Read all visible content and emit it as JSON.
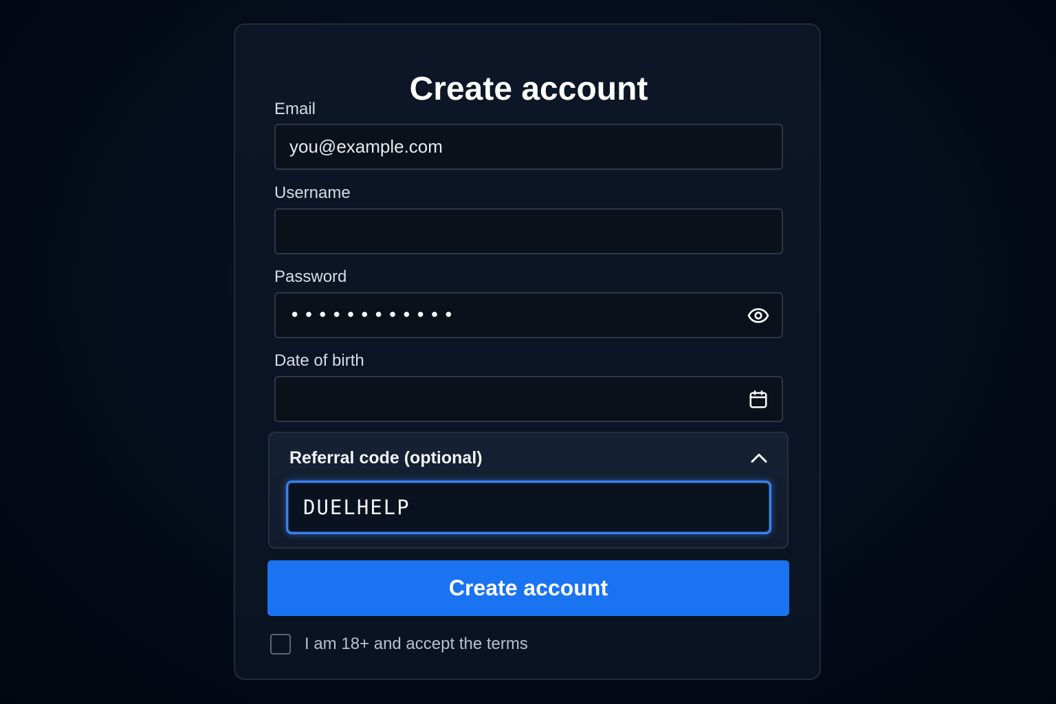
{
  "form": {
    "title": "Create account",
    "email": {
      "label": "Email",
      "placeholder": "you@example.com",
      "value": ""
    },
    "username": {
      "label": "Username",
      "placeholder": "",
      "value": ""
    },
    "password": {
      "label": "Password",
      "masked_value": "••••••••••••",
      "toggle_icon": "eye-icon"
    },
    "date_of_birth": {
      "label": "Date of birth",
      "value": "",
      "icon": "calendar-icon"
    },
    "referral": {
      "title": "Referral code (optional)",
      "expanded": true,
      "toggle_icon": "chevron-up-icon",
      "value": "DUELHELP"
    },
    "submit_label": "Create account",
    "terms": {
      "label": "I am 18+ and accept the terms",
      "checked": false
    }
  },
  "colors": {
    "accent": "#1a73f0",
    "focus_ring": "#3b82f6",
    "background": "#030a17",
    "card": "#0b1424"
  }
}
